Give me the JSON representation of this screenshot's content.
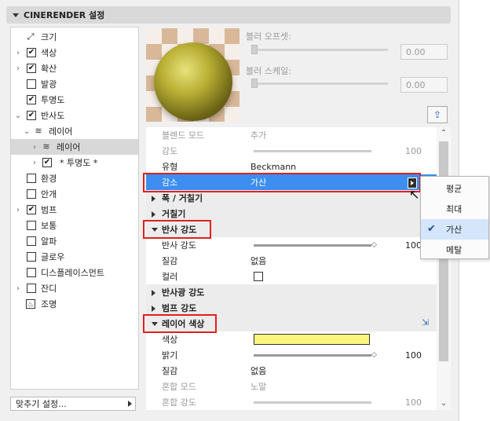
{
  "header": {
    "title": "CINERENDER 설정"
  },
  "tree": [
    {
      "label": "크기",
      "checkbox": "icon",
      "expand": false
    },
    {
      "label": "색상",
      "checkbox": true,
      "expand": true
    },
    {
      "label": "확산",
      "checkbox": true,
      "expand": true
    },
    {
      "label": "발광",
      "checkbox": false,
      "expand": false
    },
    {
      "label": "투명도",
      "checkbox": true,
      "expand": false
    },
    {
      "label": "반사도",
      "checkbox": true,
      "expand": "open"
    },
    {
      "label": "레이어",
      "checkbox": "layers",
      "expand": "open",
      "indent": 1
    },
    {
      "label": "레이어",
      "checkbox": "layers",
      "expand": true,
      "indent": 2,
      "selected": true
    },
    {
      "label": "* 투명도 *",
      "checkbox": true,
      "expand": true,
      "indent": 2
    },
    {
      "label": "환경",
      "checkbox": false,
      "expand": false
    },
    {
      "label": "안개",
      "checkbox": false,
      "expand": false
    },
    {
      "label": "범프",
      "checkbox": true,
      "expand": true
    },
    {
      "label": "보통",
      "checkbox": false,
      "expand": false
    },
    {
      "label": "알파",
      "checkbox": false,
      "expand": false
    },
    {
      "label": "글로우",
      "checkbox": false,
      "expand": false
    },
    {
      "label": "디스플레이스먼트",
      "checkbox": false,
      "expand": false
    },
    {
      "label": "잔디",
      "checkbox": false,
      "expand": true
    },
    {
      "label": "조명",
      "checkbox": "lamp",
      "expand": false
    }
  ],
  "bottom_button": "맞추기 설정...",
  "blur": {
    "offset_label": "블러 오프셋:",
    "offset_value": "0.00",
    "scale_label": "블러 스케일:",
    "scale_value": "0.00"
  },
  "props": {
    "blend_mode": {
      "name": "블렌드 모드",
      "value": "추가"
    },
    "strength": {
      "name": "강도",
      "value": "100"
    },
    "type": {
      "name": "유형",
      "value": "Beckmann"
    },
    "attenuation": {
      "name": "감소",
      "value": "가산"
    },
    "width_roughness": "폭 / 거칠기",
    "roughness": "거칠기",
    "reflection_strength_section": "반사 강도",
    "reflection_strength": {
      "name": "반사 강도",
      "value": "100"
    },
    "texture1": {
      "name": "질감",
      "value": "없음"
    },
    "color_check": {
      "name": "컬러"
    },
    "specular_strength": "반사광 강도",
    "bump_strength": "범프 강도",
    "layer_color_section": "레이어 색상",
    "color": {
      "name": "색상",
      "swatch": "#faf67c"
    },
    "brightness": {
      "name": "밝기",
      "value": "100"
    },
    "texture2": {
      "name": "질감",
      "value": "없음"
    },
    "mix_mode": {
      "name": "혼합 모드",
      "value": "노말"
    },
    "mix_strength": {
      "name": "혼합 강도",
      "value": "100"
    }
  },
  "menu": {
    "items": [
      {
        "label": "평균",
        "checked": false
      },
      {
        "label": "최대",
        "checked": false
      },
      {
        "label": "가산",
        "checked": true
      },
      {
        "label": "메탈",
        "checked": false
      }
    ]
  },
  "colors": {
    "highlight": "#3d8ef0",
    "annotation": "#e02020",
    "swatch": "#faf67c"
  }
}
